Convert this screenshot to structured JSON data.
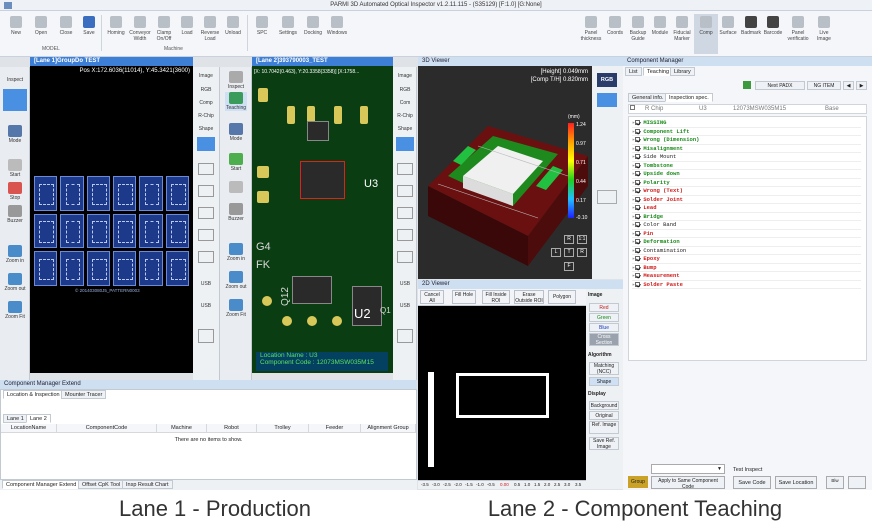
{
  "window": {
    "title": "PARMI 3D Automated Optical Inspector  v1.2.11.115 - (S35129) [F:1.0] [G:None]"
  },
  "ribbon": {
    "groups": {
      "model": "MODEL",
      "machine": "Machine"
    },
    "buttons": {
      "new": "New",
      "open": "Open",
      "close": "Close",
      "save": "Save",
      "homing": "Homing",
      "conveyor_width": "Conveyor Width",
      "clamp": "Clamp On/Off",
      "load": "Load",
      "reverse_load": "Reverse Load",
      "unload": "Unload",
      "spc": "SPC",
      "settings": "Settings",
      "docking": "Docking",
      "windows": "Windows",
      "panel_thickness": "Panel thickness",
      "coords": "Coords",
      "backup_guide": "Backup Guide",
      "module": "Module",
      "fiducial_marker": "Fiducial Marker",
      "comp": "Comp",
      "surface": "Surface",
      "badmark": "Badmark",
      "barcode": "Barcode",
      "panel_verification": "Panel verificatio",
      "live_image": "Live Image"
    }
  },
  "lane1": {
    "header": "[Lane 1]GroupDo TEST",
    "pos": "Pos X:172.6036(11014), Y:45.3421(3600)",
    "board_marking": "© 201403080J5_PATTERN0003",
    "side": {
      "inspect": "Inspect",
      "mode": "Mode",
      "start": "Start",
      "stop": "Stop",
      "buzzer": "Buzzer",
      "zoom_in": "Zoom in",
      "zoom_out": "Zoom out",
      "zoom_fit": "Zoom Fit"
    },
    "image_menu": {
      "image": "Image",
      "rgb": "RGB",
      "comp": "Comp",
      "rchip": "R-Chip",
      "shape": "Shape",
      "usb": "USB"
    }
  },
  "lane2": {
    "header": "[Lane 2]393790003_TEST",
    "pos_overlay": "[X: 10.7042(0.463), Y:20.3358(3358)] [X:1758...",
    "side": {
      "inspect": "Inspect",
      "teaching": "Teaching",
      "mode": "Mode",
      "start": "Start",
      "buzzer": "Buzzer",
      "zoom_in": "Zoom in",
      "zoom_out": "Zoom out",
      "zoom_fit": "Zoom Fit"
    },
    "image_menu": {
      "image": "Image",
      "rgb": "RGB",
      "com": "Com",
      "rchip": "R-Chip",
      "shape": "Shape",
      "usb": "USB"
    },
    "board_labels": {
      "u3": "U3",
      "g4": "G4",
      "fk": "FK",
      "q12": "Q12",
      "u2": "U2",
      "q1": "Q1"
    },
    "location_name": "Location Name : U3",
    "component_code": "Component Code : 12073MSW035M15"
  },
  "viewer3d": {
    "title": "3D Viewer",
    "height": "[Height] 0.049mm",
    "comp_th": "[Comp T/H] 0.820mm",
    "rgb": "RGB",
    "scale_unit": "(mm)",
    "scale_ticks": [
      "1.24",
      "0.97",
      "0.71",
      "0.44",
      "0.17",
      "-0.10"
    ],
    "view_buttons": [
      "R",
      "1:1",
      "L",
      "T",
      "R",
      "F"
    ]
  },
  "viewer2d": {
    "title": "2D Viewer",
    "tools": [
      "Cancel All",
      "Fill Hole",
      "Fill Inside ROI",
      "Erase Outside ROI",
      "Polygon"
    ],
    "image_label": "Image",
    "image_options": [
      "Red",
      "Green",
      "Blue",
      "Cross Section"
    ],
    "algorithm_label": "Algorithm",
    "algorithm_options": [
      "Matching (NCC)",
      "Shape"
    ],
    "display_label": "Display",
    "display_options": [
      "Background",
      "Original",
      "Ref. Image",
      "Save Ref. Image"
    ],
    "ruler": [
      "-3.5",
      "-3.0",
      "-2.5",
      "-2.0",
      "-1.5",
      "-1.0",
      "-0.5",
      "0.00",
      "0.5",
      "1.0",
      "1.5",
      "2.0",
      "2.5",
      "3.0",
      "3.5"
    ]
  },
  "component_manager": {
    "title": "Component Manager",
    "tabs": [
      "List",
      "Teaching",
      "Library"
    ],
    "next_padx": "Next PADX",
    "ng_item": "NG ITEM",
    "sub_tabs": [
      "General info.",
      "Inspection spec."
    ],
    "columns": {
      "type": "R Chip",
      "loc": "U3",
      "code": "12073MSW035M15",
      "base": "Base"
    },
    "items": [
      {
        "label": "MISSING",
        "color": "#1a8a1a"
      },
      {
        "label": "Component Lift",
        "color": "#1a8a1a"
      },
      {
        "label": "Wrong (Dimension)",
        "color": "#1a8a1a"
      },
      {
        "label": "Misalignment",
        "color": "#1a8a1a"
      },
      {
        "label": "Side Mount",
        "color": "#222222"
      },
      {
        "label": "Tombstone",
        "color": "#1a8a1a"
      },
      {
        "label": "Upside down",
        "color": "#1a8a1a"
      },
      {
        "label": "Polarity",
        "color": "#1a8a1a"
      },
      {
        "label": "Wrong (Text)",
        "color": "#d01a1a"
      },
      {
        "label": "Solder Joint",
        "color": "#d01a1a"
      },
      {
        "label": "Lead",
        "color": "#d01a1a"
      },
      {
        "label": "Bridge",
        "color": "#1a8a1a"
      },
      {
        "label": "Color Band",
        "color": "#222222"
      },
      {
        "label": "Pin",
        "color": "#d01a1a"
      },
      {
        "label": "Deformation",
        "color": "#1a8a1a"
      },
      {
        "label": "Contamination",
        "color": "#222222"
      },
      {
        "label": "Epoxy",
        "color": "#d01a1a"
      },
      {
        "label": "Bump",
        "color": "#d01a1a"
      },
      {
        "label": "Measurement",
        "color": "#d01a1a"
      },
      {
        "label": "Solder Paste",
        "color": "#d01a1a"
      }
    ],
    "bottom": {
      "group": "Group",
      "apply": "Apply to Same Component Code",
      "test_inspect": "Test Inspect",
      "save_code": "Save Code",
      "save_location": "Save Location",
      "blw": "Blw"
    }
  },
  "extend": {
    "title": "Component Manager Extend",
    "tabs": [
      "Location & Inspection",
      "Mounter Tracer"
    ],
    "lane_tabs": [
      "Lane 1",
      "Lane 2"
    ],
    "columns": [
      "LocationName",
      "ComponentCode",
      "Machine",
      "Robot",
      "Trolley",
      "Feeder",
      "Alignment Group"
    ],
    "empty": "There are no items to show.",
    "bottom_tabs": [
      "Component Manager Extend",
      "Offset CpK Tool",
      "Insp Result Chart"
    ]
  },
  "captions": {
    "lane1": "Lane 1 - Production",
    "lane2": "Lane 2 - Component Teaching"
  }
}
